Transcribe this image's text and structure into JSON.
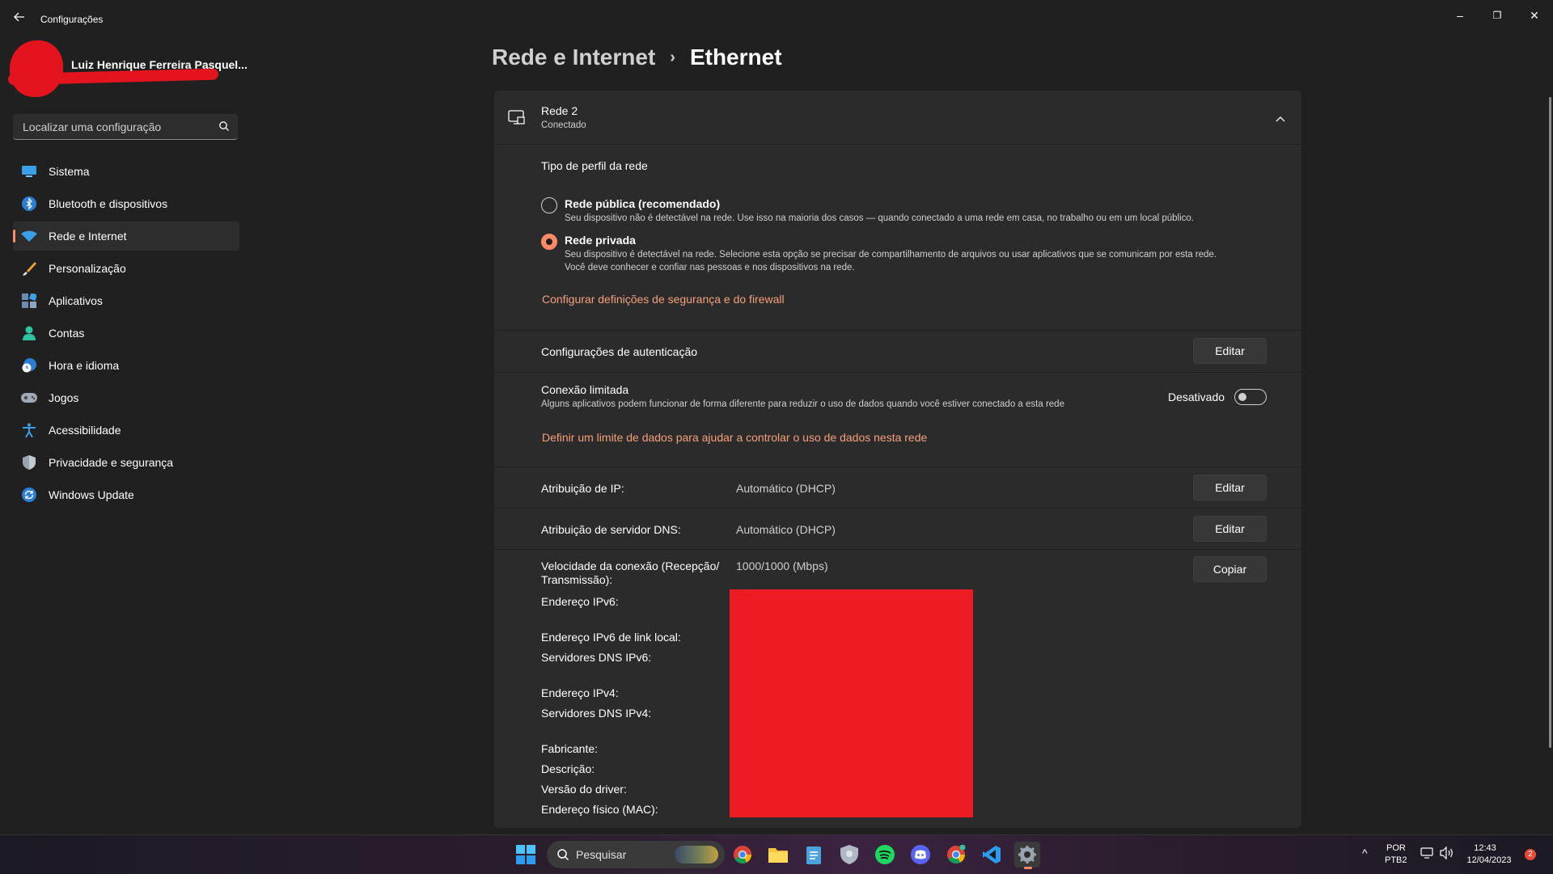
{
  "app": {
    "title": "Configurações"
  },
  "window_controls": {
    "minimize": "–",
    "maximize": "❐",
    "close": "✕"
  },
  "user": {
    "name": "Luiz Henrique Ferreira Pasquel..."
  },
  "search": {
    "placeholder": "Localizar uma configuração"
  },
  "nav": {
    "items": [
      {
        "label": "Sistema",
        "icon": "monitor-icon",
        "active": false
      },
      {
        "label": "Bluetooth e dispositivos",
        "icon": "bluetooth-icon",
        "active": false
      },
      {
        "label": "Rede e Internet",
        "icon": "wifi-icon",
        "active": true
      },
      {
        "label": "Personalização",
        "icon": "brush-icon",
        "active": false
      },
      {
        "label": "Aplicativos",
        "icon": "apps-icon",
        "active": false
      },
      {
        "label": "Contas",
        "icon": "person-icon",
        "active": false
      },
      {
        "label": "Hora e idioma",
        "icon": "clock-globe-icon",
        "active": false
      },
      {
        "label": "Jogos",
        "icon": "gamepad-icon",
        "active": false
      },
      {
        "label": "Acessibilidade",
        "icon": "accessibility-icon",
        "active": false
      },
      {
        "label": "Privacidade e segurança",
        "icon": "shield-icon",
        "active": false
      },
      {
        "label": "Windows Update",
        "icon": "update-icon",
        "active": false
      }
    ]
  },
  "breadcrumb": {
    "parent": "Rede e Internet",
    "separator": "›",
    "current": "Ethernet"
  },
  "network": {
    "name": "Rede 2",
    "status": "Conectado",
    "profile_heading": "Tipo de perfil da rede",
    "public": {
      "label": "Rede pública (recomendado)",
      "desc": "Seu dispositivo não é detectável na rede. Use isso na maioria dos casos — quando conectado a uma rede em casa, no trabalho ou em um local público.",
      "selected": false
    },
    "private": {
      "label": "Rede privada",
      "desc1": "Seu dispositivo é detectável na rede. Selecione esta opção se precisar de compartilhamento de arquivos ou usar aplicativos que se comunicam por esta rede.",
      "desc2": "Você deve conhecer e confiar nas pessoas e nos dispositivos na rede.",
      "selected": true
    },
    "firewall_link": "Configurar definições de segurança e do firewall",
    "auth": {
      "label": "Configurações de autenticação",
      "button": "Editar"
    },
    "metered": {
      "label": "Conexão limitada",
      "desc": "Alguns aplicativos podem funcionar de forma diferente para reduzir o uso de dados quando você estiver conectado a esta rede",
      "toggle_label": "Desativado",
      "toggle_on": false,
      "link": "Definir um limite de dados para ajudar a controlar o uso de dados nesta rede"
    },
    "ip": {
      "label": "Atribuição de IP:",
      "value": "Automático (DHCP)",
      "button": "Editar"
    },
    "dns": {
      "label": "Atribuição de servidor DNS:",
      "value": "Automático (DHCP)",
      "button": "Editar"
    },
    "properties": {
      "speed_label_1": "Velocidade da conexão (Recepção/",
      "speed_label_2": "Transmissão):",
      "speed_value": "1000/1000 (Mbps)",
      "copy_button": "Copiar",
      "ipv6": "Endereço IPv6:",
      "ipv6_link_local": "Endereço IPv6 de link local:",
      "ipv6_dns": "Servidores DNS IPv6:",
      "ipv4": "Endereço IPv4:",
      "ipv4_dns": "Servidores DNS IPv4:",
      "manufacturer": "Fabricante:",
      "description": "Descrição:",
      "driver_version": "Versão do driver:",
      "mac": "Endereço físico (MAC):"
    }
  },
  "taskbar": {
    "search_label": "Pesquisar",
    "language_1": "POR",
    "language_2": "PTB2",
    "time": "12:43",
    "date": "12/04/2023",
    "notification_count": "2",
    "pinned": [
      "windows-start-icon",
      "chrome-icon",
      "file-explorer-icon",
      "notepad-icon",
      "shield-app-icon",
      "spotify-icon",
      "discord-icon",
      "chrome-profile-icon",
      "vscode-icon",
      "settings-icon"
    ]
  },
  "colors": {
    "accent": "#ff8a65",
    "link": "#f5a07a",
    "redaction": "#ed1c24"
  }
}
